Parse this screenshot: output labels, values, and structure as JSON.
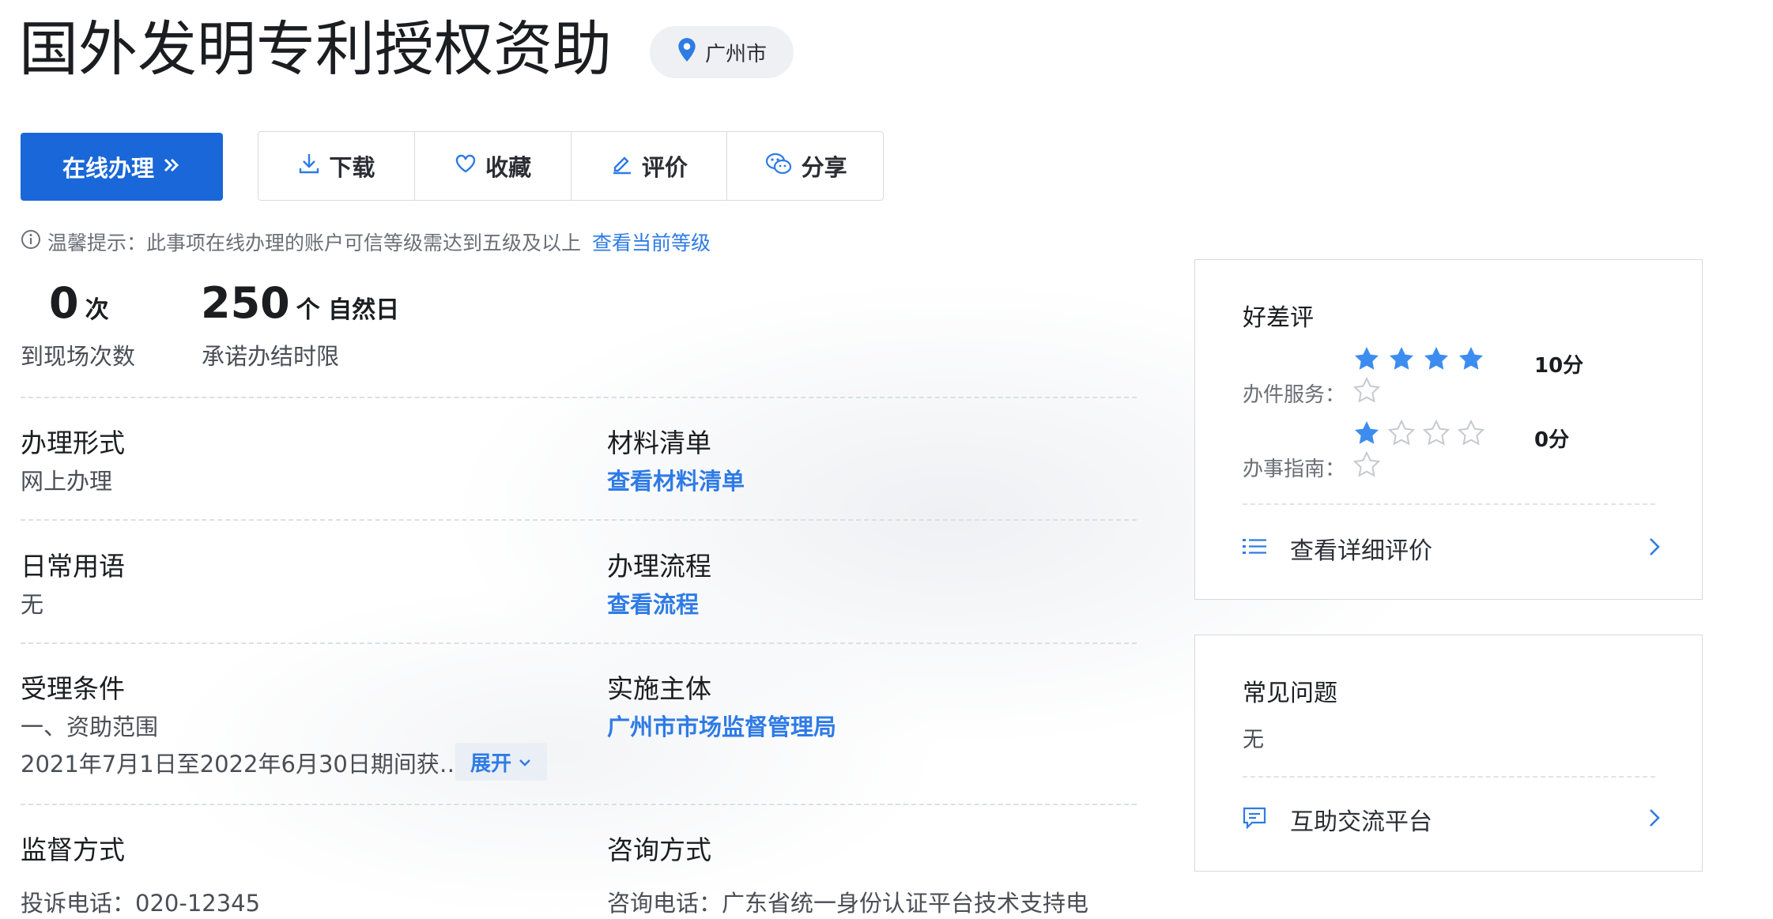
{
  "header": {
    "title": "国外发明专利授权资助",
    "location": "广州市"
  },
  "actions": {
    "online_label": "在线办理",
    "download_label": "下载",
    "favorite_label": "收藏",
    "review_label": "评价",
    "share_label": "分享"
  },
  "tip": {
    "text": "温馨提示：此事项在线办理的账户可信等级需达到五级及以上",
    "link": "查看当前等级"
  },
  "stats": [
    {
      "value": "0",
      "unit": "次",
      "label": "到现场次数"
    },
    {
      "value": "250",
      "unit": "个 自然日",
      "label": "承诺办结时限"
    }
  ],
  "items": {
    "form": {
      "title": "办理形式",
      "value": "网上办理"
    },
    "materials": {
      "title": "材料清单",
      "link": "查看材料清单"
    },
    "terms": {
      "title": "日常用语",
      "value": "无"
    },
    "process": {
      "title": "办理流程",
      "link": "查看流程"
    },
    "conditions": {
      "title": "受理条件",
      "line1": "一、资助范围",
      "line2": "2021年7月1日至2022年6月30日期间获…",
      "expand": "展开"
    },
    "agency": {
      "title": "实施主体",
      "link": "广州市市场监督管理局"
    },
    "supervision": {
      "title": "监督方式",
      "value": "投诉电话：020-12345"
    },
    "consult": {
      "title": "咨询方式",
      "value": "咨询电话：广东省统一身份认证平台技术支持电"
    }
  },
  "rating_card": {
    "title": "好差评",
    "rows": [
      {
        "label": "办件服务：",
        "stars_filled": 4,
        "stars_total": 5,
        "score": "10分"
      },
      {
        "label": "办事指南：",
        "stars_filled": 1,
        "stars_total": 5,
        "score": "0分"
      }
    ],
    "detail_link": "查看详细评价"
  },
  "faq_card": {
    "title": "常见问题",
    "value": "无",
    "link": "互助交流平台"
  },
  "colors": {
    "primary": "#1967d8",
    "link": "#2e7be6",
    "star": "#3d8df0",
    "star_empty": "#c5c9d0"
  },
  "icons": [
    "location-pin-icon",
    "double-chevron-right-icon",
    "download-icon",
    "heart-icon",
    "edit-icon",
    "wechat-icon",
    "info-icon",
    "chevron-down-icon",
    "list-icon",
    "chevron-right-icon",
    "comment-icon",
    "star-icon"
  ]
}
